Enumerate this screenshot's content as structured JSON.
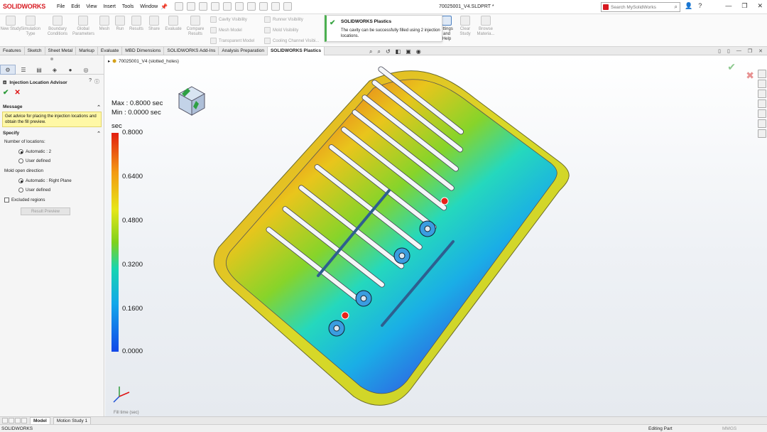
{
  "app": {
    "logo": "SOLIDWORKS",
    "doc_title": "70025001_V4.SLDPRT *"
  },
  "menu": [
    "File",
    "Edit",
    "View",
    "Insert",
    "Tools",
    "Window"
  ],
  "search": {
    "placeholder": "Search MySolidWorks"
  },
  "ribbon": {
    "buttons": [
      "New Study",
      "Simulation Type",
      "Boundary Conditions",
      "Global Parameters",
      "Mesh",
      "Run",
      "Results",
      "Share",
      "Evaluate",
      "Compare Results",
      "Clear Study",
      "Browse Materia..."
    ],
    "small_col1": [
      "Cavity Visibility",
      "Mesh Model",
      "Transparent Model"
    ],
    "small_col2": [
      "Runner Visibility",
      "Mold Visibility",
      "Cooling Channel Visibi..."
    ],
    "settings_label": "ettings and Help"
  },
  "notification": {
    "title": "SOLIDWORKS Plastics",
    "body": "The cavity can be successfully filled using 2 injection locations."
  },
  "tabs": [
    "Features",
    "Sketch",
    "Sheet Metal",
    "Markup",
    "Evaluate",
    "MBD Dimensions",
    "SOLIDWORKS Add-Ins",
    "Analysis Preparation",
    "SOLIDWORKS Plastics"
  ],
  "active_tab": "SOLIDWORKS Plastics",
  "panel": {
    "title": "Injection Location Advisor",
    "message_header": "Message",
    "message": "Get advice for placing the injection locations and obtain the fill preview.",
    "specify_header": "Specify",
    "num_locations_label": "Number of locations:",
    "num_opt1": "Automatic : 2",
    "num_opt2": "User defined",
    "mold_dir_label": "Mold open direction",
    "mold_opt1": "Automatic : Right Plane",
    "mold_opt2": "User defined",
    "excluded_label": "Excluded regions",
    "preview_button": "Result Preview"
  },
  "viewport": {
    "tree_node": "70025001_V4 (slotted_holes)",
    "legend": {
      "max": "Max : 0.8000 sec",
      "min": "Min : 0.0000 sec",
      "unit": "sec",
      "ticks": [
        "0.8000",
        "0.6400",
        "0.4800",
        "0.3200",
        "0.1600",
        "0.0000"
      ]
    },
    "truncated_label": "Fill time (sec)"
  },
  "bottom_tabs": [
    "Model",
    "Motion Study 1"
  ],
  "status": {
    "left": "SOLIDWORKS",
    "mode": "Editing Part",
    "units": "MMGS"
  },
  "colors": {
    "brand": "#d71920",
    "notify_accent": "#4caf50",
    "message_bg": "#fff8a6"
  }
}
